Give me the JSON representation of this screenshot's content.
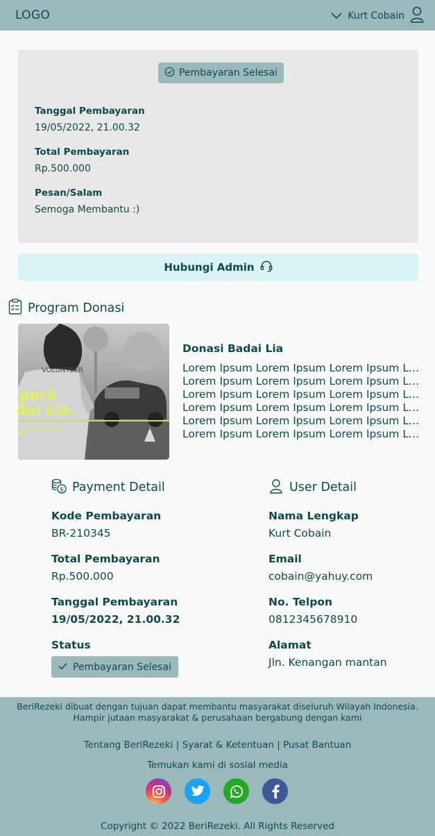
{
  "header": {
    "logo": "LOGO",
    "user_name": "Kurt Cobain"
  },
  "summary": {
    "status": "Pembayaran Selesai",
    "date_label": "Tanggal Pembayaran",
    "date_value": "19/05/2022, 21.00.32",
    "total_label": "Total Pembayaran",
    "total_value": "Rp.500.000",
    "message_label": "Pesan/Salam",
    "message_value": "Semoga Membantu :)"
  },
  "contact_admin": "Hubungi Admin",
  "program": {
    "section_title": "Program Donasi",
    "name": "Donasi Badai Lia",
    "image_text": {
      "line1": "para",
      "line2": "dai Lia.",
      "brand": "BeriRezeki Charity",
      "shirt": "VOLUNTEER"
    },
    "description_lines": [
      "Lorem Ipsum Lorem Ipsum Lorem Ipsum Lore",
      "Lorem Ipsum Lorem Ipsum Lorem Ipsum Lore",
      "Lorem Ipsum Lorem Ipsum Lorem Ipsum Lore",
      "Lorem Ipsum Lorem Ipsum Lorem Ipsum Lore",
      "Lorem Ipsum Lorem Ipsum Lorem Ipsum Lore",
      "Lorem Ipsum Lorem Ipsum Lorem Ipsum Lo..."
    ]
  },
  "payment_detail": {
    "title": "Payment Detail",
    "code_label": "Kode Pembayaran",
    "code_value": "BR-210345",
    "total_label": "Total Pembayaran",
    "total_value": "Rp.500.000",
    "date_label": "Tanggal Pembayaran",
    "date_value": "19/05/2022, 21.00.32",
    "status_label": "Status",
    "status_value": "Pembayaran Selesai"
  },
  "user_detail": {
    "title": "User Detail",
    "name_label": "Nama Lengkap",
    "name_value": "Kurt Cobain",
    "email_label": "Email",
    "email_value": "cobain@yahuy.com",
    "phone_label": "No. Telpon",
    "phone_value": "0812345678910",
    "address_label": "Alamat",
    "address_value": "Jln. Kenangan mantan"
  },
  "footer": {
    "about_line1": "BeriRezeki dibuat dengan tujuan dapat membantu masyarakat diseluruh Wilayah Indonesia.",
    "about_line2": "Hampir jutaan masyarakat & perusahaan bergabung dengan kami",
    "link_about": "Tentang BeriRezeki",
    "link_terms": "Syarat & Ketentuan",
    "link_help": "Pusat Bantuan",
    "separator": "|",
    "find_us": "Temukan kami di sosial media",
    "copyright": "Copyright © 2022 BeriRezeki. All Rights Reserved",
    "socials": [
      "instagram-icon",
      "twitter-icon",
      "whatsapp-icon",
      "facebook-icon"
    ]
  },
  "colors": {
    "primary_dark": "#0e4a4d",
    "header_bg": "#9bb9ba",
    "card_bg": "#e8e8e8",
    "admin_btn_bg": "#d8f4f5",
    "instagram": "#c13584",
    "twitter": "#1da1f2",
    "whatsapp": "#25a825",
    "facebook": "#3b5998"
  }
}
